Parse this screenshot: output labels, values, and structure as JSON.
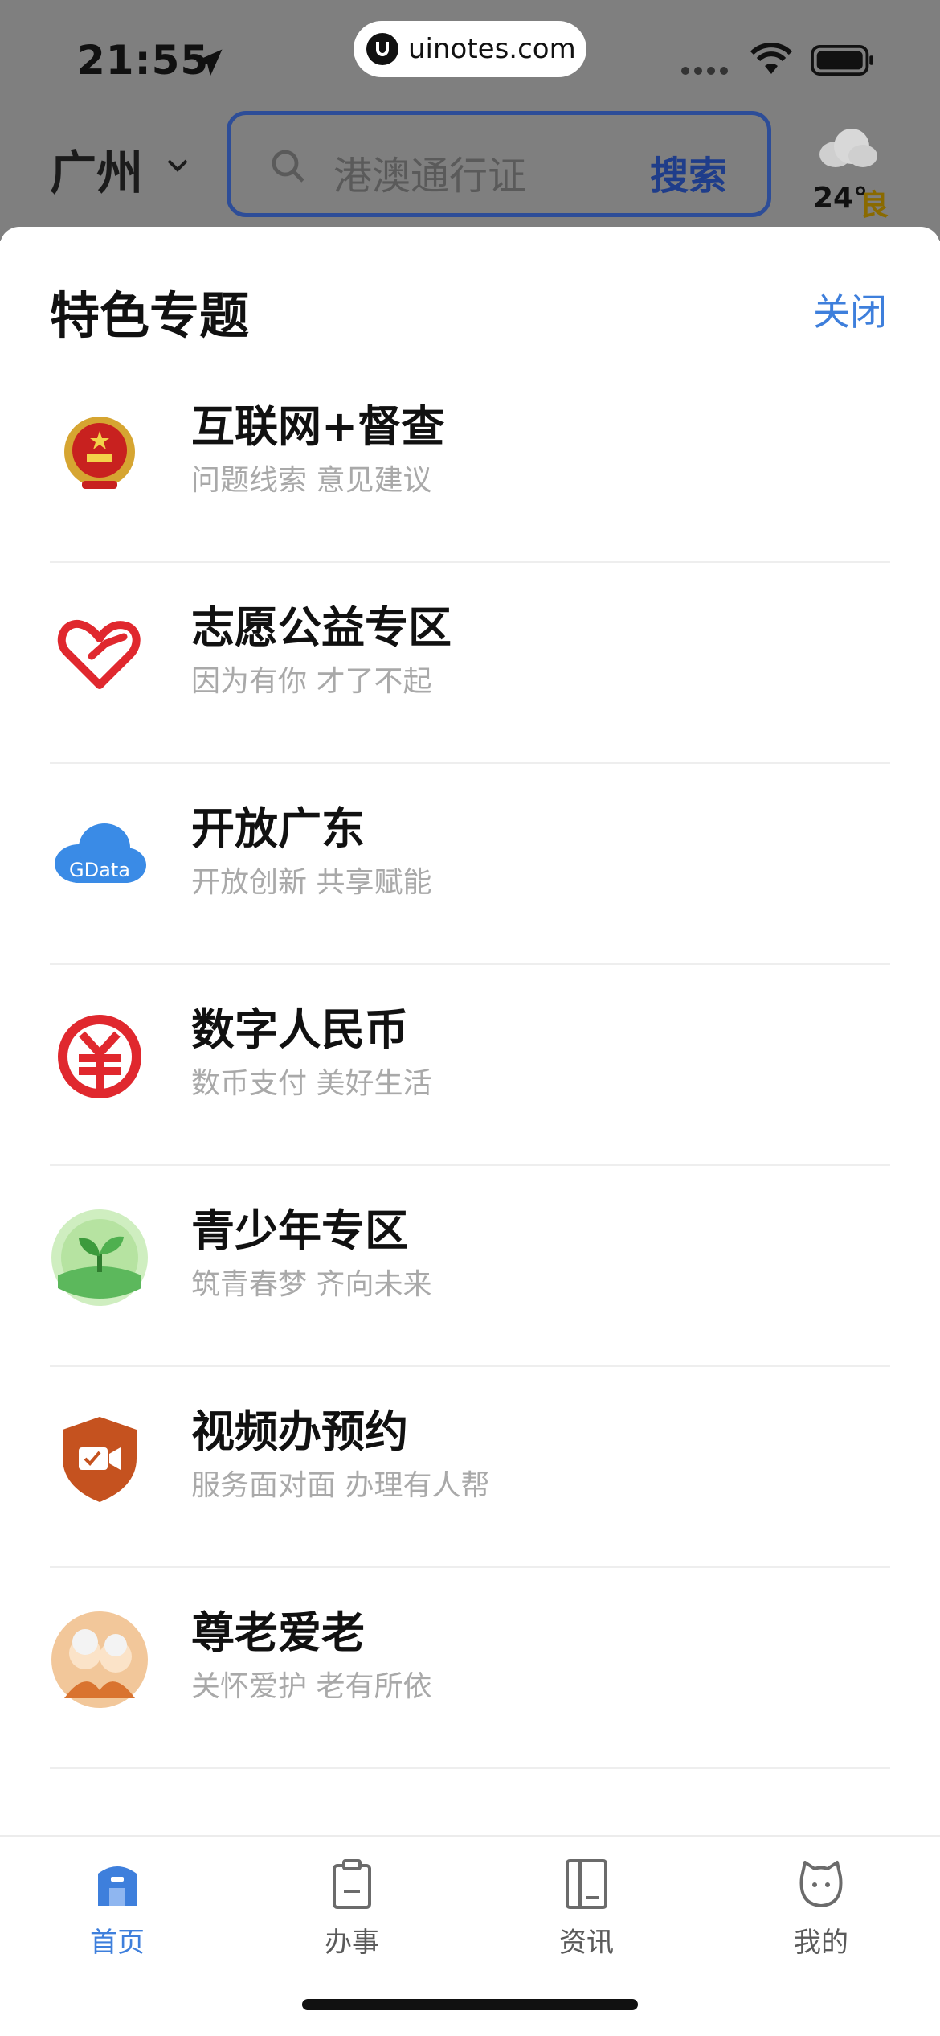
{
  "status_bar": {
    "time": "21:55",
    "url": "uinotes.com"
  },
  "header": {
    "city": "广州",
    "search_placeholder": "港澳通行证",
    "search_button": "搜索",
    "weather_temp": "24°",
    "weather_aqi": "良"
  },
  "sheet": {
    "title": "特色专题",
    "close_label": "关闭",
    "items": [
      {
        "title": "互联网+督查",
        "subtitle": "问题线索 意见建议",
        "icon": "national-emblem-icon"
      },
      {
        "title": "志愿公益专区",
        "subtitle": "因为有你 才了不起",
        "icon": "volunteer-heart-icon"
      },
      {
        "title": "开放广东",
        "subtitle": "开放创新 共享赋能",
        "icon": "gdata-cloud-icon"
      },
      {
        "title": "数字人民币",
        "subtitle": "数币支付 美好生活",
        "icon": "digital-rmb-icon"
      },
      {
        "title": "青少年专区",
        "subtitle": "筑青春梦 齐向未来",
        "icon": "sprout-icon"
      },
      {
        "title": "视频办预约",
        "subtitle": "服务面对面 办理有人帮",
        "icon": "video-shield-icon"
      },
      {
        "title": "尊老爱老",
        "subtitle": "关怀爱护 老有所依",
        "icon": "elderly-couple-icon"
      }
    ],
    "gdata_text": "GData"
  },
  "tabbar": {
    "tabs": [
      {
        "label": "首页",
        "icon": "home-icon",
        "active": true
      },
      {
        "label": "办事",
        "icon": "clipboard-icon",
        "active": false
      },
      {
        "label": "资讯",
        "icon": "news-icon",
        "active": false
      },
      {
        "label": "我的",
        "icon": "profile-icon",
        "active": false
      }
    ]
  },
  "colors": {
    "accent": "#3e7fdc",
    "search_border": "#2d4d98"
  }
}
